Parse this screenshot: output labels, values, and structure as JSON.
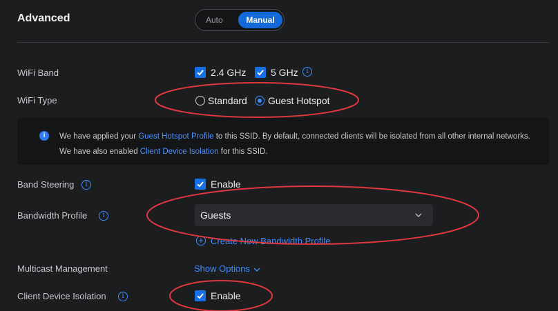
{
  "section": {
    "title": "Advanced",
    "mode_auto": "Auto",
    "mode_manual": "Manual"
  },
  "rows": {
    "wifi_band": {
      "label": "WiFi Band",
      "opt1": "2.4 GHz",
      "opt2": "5 GHz"
    },
    "wifi_type": {
      "label": "WiFi Type",
      "opt1": "Standard",
      "opt2": "Guest Hotspot"
    },
    "band_steering": {
      "label": "Band Steering",
      "value": "Enable"
    },
    "bandwidth_profile": {
      "label": "Bandwidth Profile",
      "selected": "Guests",
      "create_link": "Create New Bandwidth Profile"
    },
    "multicast": {
      "label": "Multicast Management",
      "show_options": "Show Options"
    },
    "isolation": {
      "label": "Client Device Isolation",
      "value": "Enable"
    }
  },
  "banner": {
    "t1": "We have applied your ",
    "link1": "Guest Hotspot Profile",
    "t2": " to this SSID. By default, connected clients will be isolated from all other internal networks. We have also enabled ",
    "link2": "Client Device Isolation",
    "t3": " for this SSID."
  },
  "colors": {
    "accent": "#1469d9",
    "annotation": "#e0383e",
    "background": "#1c1d1f"
  }
}
